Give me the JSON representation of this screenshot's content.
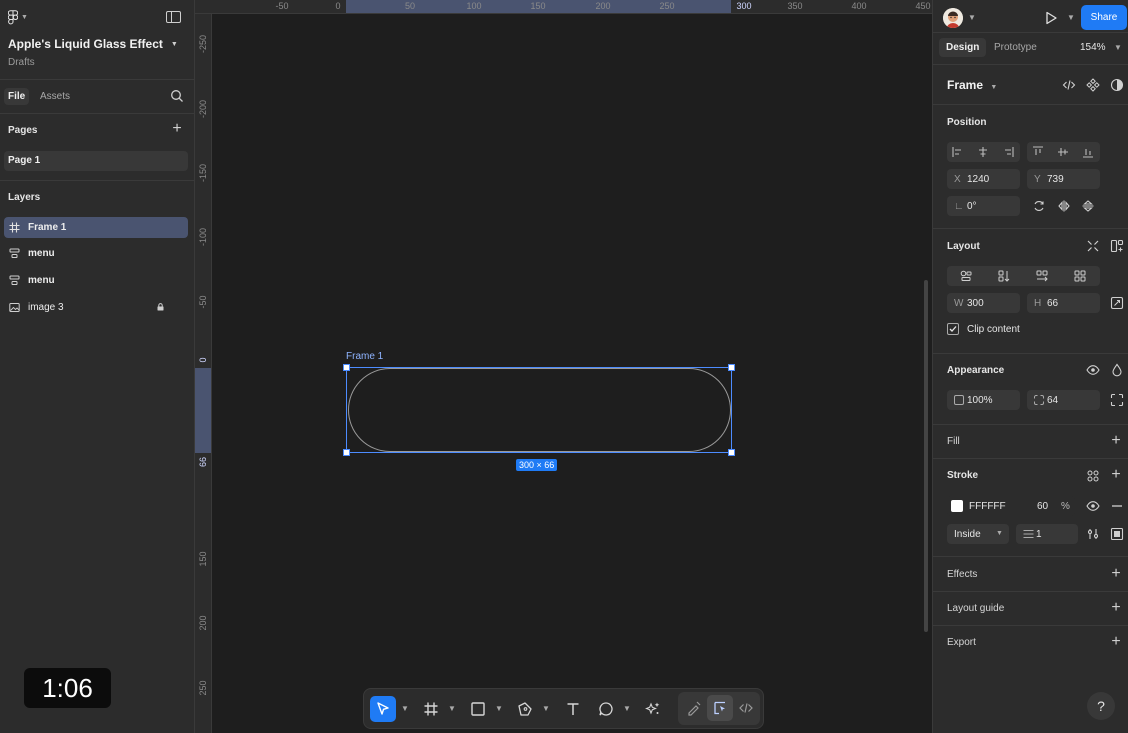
{
  "file": {
    "title": "Apple's Liquid Glass Effect",
    "location": "Drafts"
  },
  "left_tabs": {
    "file": "File",
    "assets": "Assets"
  },
  "pages": {
    "label": "Pages",
    "items": [
      {
        "name": "Page 1"
      }
    ]
  },
  "layers": {
    "label": "Layers",
    "items": [
      {
        "name": "Frame 1",
        "icon": "frame-icon",
        "selected": true
      },
      {
        "name": "menu",
        "icon": "auto-layout-icon"
      },
      {
        "name": "menu",
        "icon": "auto-layout-icon"
      },
      {
        "name": "image 3",
        "icon": "image-icon",
        "locked": true
      }
    ]
  },
  "rulers": {
    "top": [
      "-50",
      "0",
      "50",
      "100",
      "150",
      "200",
      "250",
      "300",
      "350",
      "400",
      "450"
    ],
    "left": [
      "-250",
      "-200",
      "-150",
      "-100",
      "-50",
      "0",
      "66",
      "150",
      "200",
      "250"
    ]
  },
  "canvas": {
    "frame_label": "Frame 1",
    "size_badge": "300 × 66"
  },
  "video_timer": "1:06",
  "right": {
    "share": "Share",
    "tabs": {
      "design": "Design",
      "prototype": "Prototype"
    },
    "zoom": "154%",
    "selection": "Frame",
    "position": {
      "label": "Position",
      "x": "1240",
      "y": "739",
      "rotation": "0°"
    },
    "layout": {
      "label": "Layout",
      "w": "300",
      "h": "66",
      "clip_content": "Clip content"
    },
    "appearance": {
      "label": "Appearance",
      "opacity": "100%",
      "radius": "64"
    },
    "fill": {
      "label": "Fill"
    },
    "stroke": {
      "label": "Stroke",
      "color": "FFFFFF",
      "opacity": "60",
      "percent": "%",
      "position": "Inside",
      "weight": "1"
    },
    "effects": {
      "label": "Effects"
    },
    "layout_guide": {
      "label": "Layout guide"
    },
    "export": {
      "label": "Export"
    },
    "help": "?"
  },
  "colors": {
    "accent": "#1f7bf5",
    "selection": "#4d8cff",
    "panel": "#2c2c2c",
    "canvas": "#1e1e1e"
  }
}
